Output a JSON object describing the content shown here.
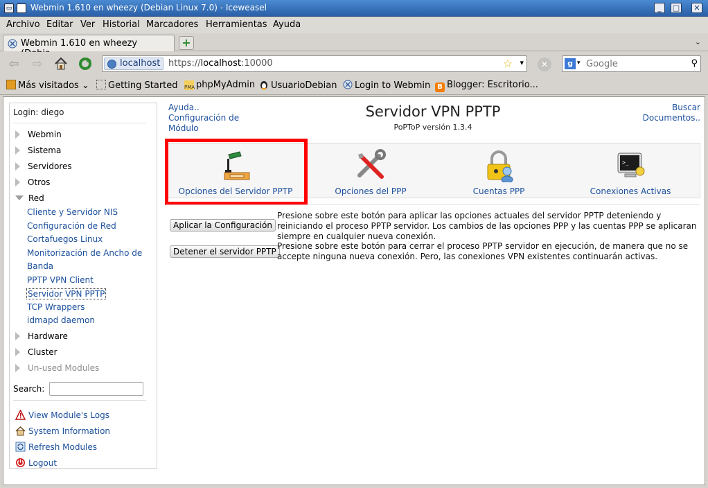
{
  "window": {
    "title": "Webmin 1.610 en wheezy (Debian Linux 7.0) - Iceweasel",
    "controls": [
      "minimize-icon",
      "maximize-icon",
      "close-icon"
    ]
  },
  "menubar": {
    "items": [
      "Archivo",
      "Editar",
      "Ver",
      "Historial",
      "Marcadores",
      "Herramientas",
      "Ayuda"
    ]
  },
  "tabs": {
    "active_label": "Webmin 1.610 en wheezy (Debia...",
    "new_tab_label": "+"
  },
  "navbar": {
    "site_identity": "localhost",
    "url_prefix": "https://",
    "url_host": "localhost",
    "url_suffix": ":10000",
    "search_placeholder": "Google"
  },
  "bookmarks": [
    {
      "label": "Más visitados",
      "icon": "folder-icon"
    },
    {
      "label": "Getting Started",
      "icon": "page-icon"
    },
    {
      "label": "phpMyAdmin",
      "icon": "pma-icon"
    },
    {
      "label": "UsuarioDebian",
      "icon": "tux-icon"
    },
    {
      "label": "Login to Webmin",
      "icon": "webmin-icon"
    },
    {
      "label": "Blogger: Escritorio...",
      "icon": "blogger-icon"
    }
  ],
  "sidebar": {
    "login": "Login: diego",
    "categories": [
      {
        "label": "Webmin"
      },
      {
        "label": "Sistema"
      },
      {
        "label": "Servidores"
      },
      {
        "label": "Otros"
      },
      {
        "label": "Red"
      }
    ],
    "red_items": [
      "Cliente y Servidor NIS",
      "Configuración de Red",
      "Cortafuegos Linux",
      "Monitorización de Ancho de",
      "Banda",
      "PPTP VPN Client",
      "Servidor VPN PPTP",
      "TCP Wrappers",
      "idmapd daemon"
    ],
    "categories_after": [
      {
        "label": "Hardware"
      },
      {
        "label": "Cluster"
      },
      {
        "label": "Un-used Modules"
      }
    ],
    "search_label": "Search:",
    "tools": [
      {
        "label": "View Module's Logs"
      },
      {
        "label": "System Information"
      },
      {
        "label": "Refresh Modules"
      },
      {
        "label": "Logout"
      }
    ]
  },
  "main": {
    "help_link": "Ayuda..",
    "config_link_line1": "Configuración de",
    "config_link_line2": "Módulo",
    "search_link": "Buscar",
    "docs_link": "Documentos..",
    "title": "Servidor VPN PPTP",
    "subtitle": "PoPToP versión 1.3.4",
    "icons": [
      {
        "label": "Opciones del Servidor PPTP",
        "icon": "desk-lamp-icon"
      },
      {
        "label": "Opciones del PPP",
        "icon": "tools-icon"
      },
      {
        "label": "Cuentas PPP",
        "icon": "lock-user-icon"
      },
      {
        "label": "Conexiones Activas",
        "icon": "terminal-icon"
      }
    ],
    "actions": [
      {
        "button": "Aplicar la Configuración",
        "desc": "Presione sobre este botón para aplicar las opciones actuales del servidor PPTP deteniendo y reiniciando el proceso PPTP servidor. Los cambios de las opciones PPP y las cuentas PPP se aplicaran siempre en cualquier nueva conexión."
      },
      {
        "button": "Detener el servidor PPTP",
        "desc": "Presione sobre este botón para cerrar el proceso PPTP servidor en ejecución, de manera que no se accepte ninguna nueva conexión. Pero, las conexiones VPN existentes continuarán activas."
      }
    ]
  },
  "colors": {
    "link": "#1b4f9c",
    "highlight": "#ff0000",
    "titlebar": "#3a74c0"
  }
}
